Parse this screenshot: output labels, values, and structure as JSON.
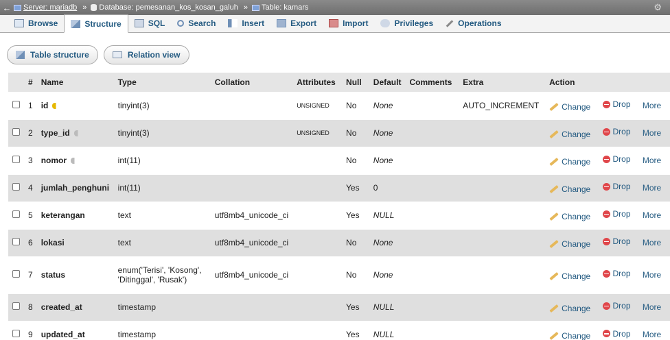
{
  "breadcrumb": {
    "back": "←",
    "server": "Server: mariadb",
    "database": "Database: pemesanan_kos_kosan_galuh",
    "table": "Table: kamars",
    "separator": "»"
  },
  "tabs": [
    {
      "label": "Browse",
      "active": false
    },
    {
      "label": "Structure",
      "active": true
    },
    {
      "label": "SQL",
      "active": false
    },
    {
      "label": "Search",
      "active": false
    },
    {
      "label": "Insert",
      "active": false
    },
    {
      "label": "Export",
      "active": false
    },
    {
      "label": "Import",
      "active": false
    },
    {
      "label": "Privileges",
      "active": false
    },
    {
      "label": "Operations",
      "active": false
    }
  ],
  "subtabs": {
    "table_structure": "Table structure",
    "relation_view": "Relation view"
  },
  "columns": [
    "#",
    "Name",
    "Type",
    "Collation",
    "Attributes",
    "Null",
    "Default",
    "Comments",
    "Extra",
    "Action"
  ],
  "actions": {
    "change": "Change",
    "drop": "Drop",
    "more": "More"
  },
  "rows": [
    {
      "num": "1",
      "name": "id",
      "key": "primary",
      "type": "tinyint(3)",
      "collation": "",
      "attributes": "UNSIGNED",
      "null": "No",
      "default": "None",
      "comments": "",
      "extra": "AUTO_INCREMENT"
    },
    {
      "num": "2",
      "name": "type_id",
      "key": "index",
      "type": "tinyint(3)",
      "collation": "",
      "attributes": "UNSIGNED",
      "null": "No",
      "default": "None",
      "comments": "",
      "extra": ""
    },
    {
      "num": "3",
      "name": "nomor",
      "key": "index",
      "type": "int(11)",
      "collation": "",
      "attributes": "",
      "null": "No",
      "default": "None",
      "comments": "",
      "extra": ""
    },
    {
      "num": "4",
      "name": "jumlah_penghuni",
      "key": "",
      "type": "int(11)",
      "collation": "",
      "attributes": "",
      "null": "Yes",
      "default": "0",
      "comments": "",
      "extra": ""
    },
    {
      "num": "5",
      "name": "keterangan",
      "key": "",
      "type": "text",
      "collation": "utf8mb4_unicode_ci",
      "attributes": "",
      "null": "Yes",
      "default": "NULL",
      "comments": "",
      "extra": ""
    },
    {
      "num": "6",
      "name": "lokasi",
      "key": "",
      "type": "text",
      "collation": "utf8mb4_unicode_ci",
      "attributes": "",
      "null": "No",
      "default": "None",
      "comments": "",
      "extra": ""
    },
    {
      "num": "7",
      "name": "status",
      "key": "",
      "type": "enum('Terisi', 'Kosong', 'Ditinggal', 'Rusak')",
      "collation": "utf8mb4_unicode_ci",
      "attributes": "",
      "null": "No",
      "default": "None",
      "comments": "",
      "extra": ""
    },
    {
      "num": "8",
      "name": "created_at",
      "key": "",
      "type": "timestamp",
      "collation": "",
      "attributes": "",
      "null": "Yes",
      "default": "NULL",
      "comments": "",
      "extra": ""
    },
    {
      "num": "9",
      "name": "updated_at",
      "key": "",
      "type": "timestamp",
      "collation": "",
      "attributes": "",
      "null": "Yes",
      "default": "NULL",
      "comments": "",
      "extra": ""
    }
  ],
  "colors": {
    "link": "#235a81",
    "header_bg": "#e5e5e5",
    "even_row": "#dfdfdf",
    "topbar": "#7a7a7a"
  }
}
